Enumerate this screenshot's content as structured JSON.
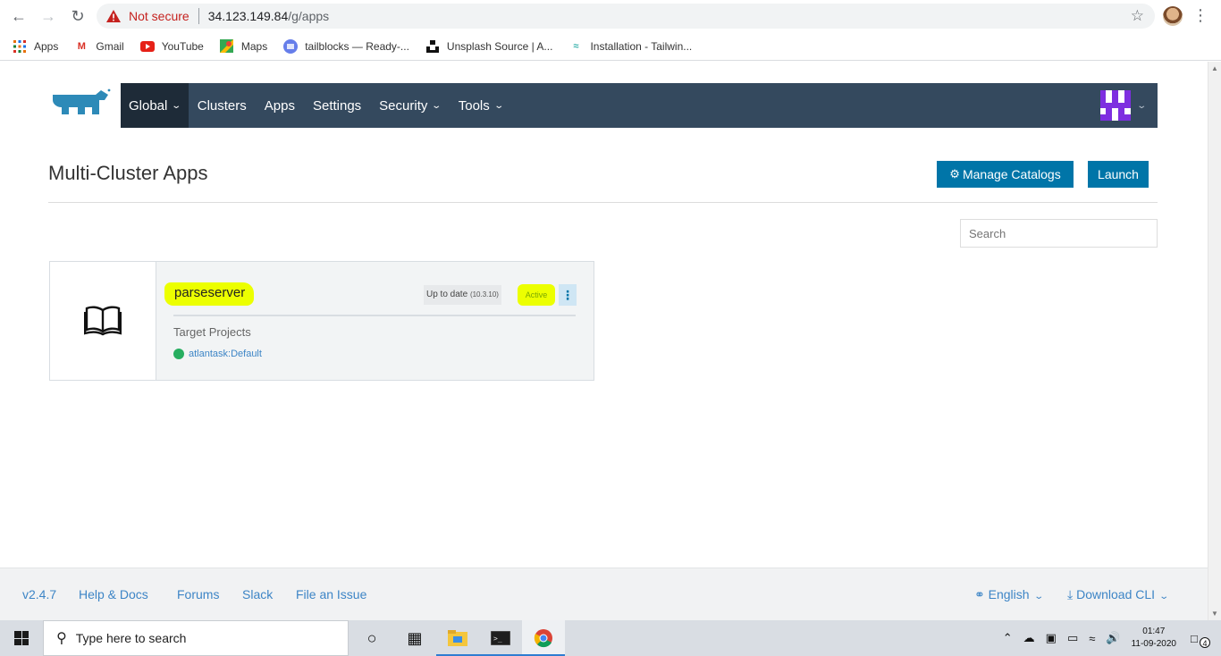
{
  "browser": {
    "not_secure_label": "Not secure",
    "url_host": "34.123.149.84",
    "url_path": "/g/apps",
    "bookmarks": [
      {
        "label": "Apps",
        "icon": "apps-grid-icon"
      },
      {
        "label": "Gmail",
        "icon": "gmail-icon"
      },
      {
        "label": "YouTube",
        "icon": "youtube-icon"
      },
      {
        "label": "Maps",
        "icon": "maps-icon"
      },
      {
        "label": "tailblocks — Ready-...",
        "icon": "tailblocks-icon"
      },
      {
        "label": "Unsplash Source | A...",
        "icon": "unsplash-icon"
      },
      {
        "label": "Installation - Tailwin...",
        "icon": "tailwind-icon"
      }
    ]
  },
  "topnav": {
    "items": [
      {
        "label": "Global",
        "dropdown": true,
        "active": true
      },
      {
        "label": "Clusters",
        "dropdown": false
      },
      {
        "label": "Apps",
        "dropdown": false
      },
      {
        "label": "Settings",
        "dropdown": false
      },
      {
        "label": "Security",
        "dropdown": true
      },
      {
        "label": "Tools",
        "dropdown": true
      }
    ],
    "bg_color": "#34495e",
    "active_color": "#1e2b38"
  },
  "main": {
    "title": "Multi-Cluster Apps",
    "manage_catalogs_label": "Manage Catalogs",
    "launch_label": "Launch",
    "search_placeholder": "Search",
    "accent_color": "#0075a8"
  },
  "app": {
    "name": "parseserver",
    "upgrade_status": "Up to date",
    "version": "(10.3.10)",
    "state": "Active",
    "actions_icon": "⋮",
    "target_projects_label": "Target Projects",
    "project": "atlantask:Default",
    "highlight_color": "#ecff00",
    "state_color": "#27ae60"
  },
  "footer": {
    "version": "v2.4.7",
    "help": "Help & Docs",
    "forums": "Forums",
    "slack": "Slack",
    "issue": "File an Issue",
    "language": "English",
    "download": "Download CLI"
  },
  "taskbar": {
    "search_placeholder": "Type here to search",
    "time": "01:47",
    "date": "11-09-2020",
    "notification_count": "4"
  }
}
